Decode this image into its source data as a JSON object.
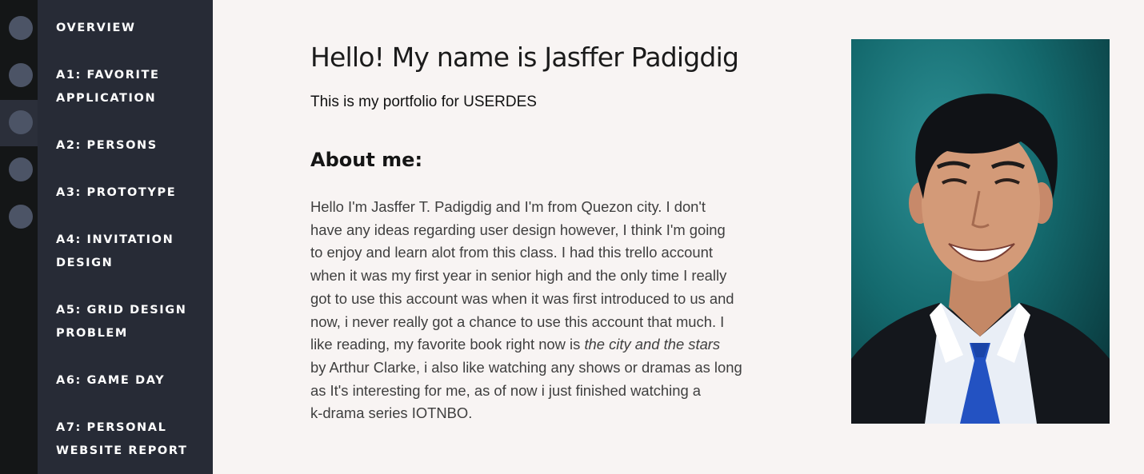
{
  "nav": {
    "items": [
      {
        "label": "OVERVIEW"
      },
      {
        "label": "A1: FAVORITE APPLICATION"
      },
      {
        "label": "A2: PERSONS"
      },
      {
        "label": "A3: PROTOTYPE"
      },
      {
        "label": "A4: INVITATION DESIGN"
      },
      {
        "label": "A5: GRID DESIGN PROBLEM"
      },
      {
        "label": "A6: GAME DAY"
      },
      {
        "label": "A7: PERSONAL WEBSITE REPORT"
      }
    ],
    "active_dot": 3
  },
  "main": {
    "heading": "Hello! My name is Jasffer Padigdig",
    "subheading": "This is my portfolio for USERDES",
    "about_title": "About me:",
    "bio": {
      "line1": "Hello I'm Jasffer T. Padigdig and I'm from Quezon city. I don't",
      "line2": "have any ideas regarding user design however, I think I'm going",
      "line3": "to enjoy and learn alot from this class. I had this trello account",
      "line4": "when it was my first year in senior high and the only time I really",
      "line5": "got to use this account was when it was first introduced to us and",
      "line6": "now, i never really got a chance to use this account that much. I",
      "line7_pre": "like reading, my favorite book right now is ",
      "line7_book": "the city and the stars",
      "line8": "by Arthur Clarke, i also like watching any shows or dramas as long",
      "line9": "as It's interesting for me, as of now i just finished watching a",
      "line10": "k-drama series IOTNBO."
    }
  },
  "colors": {
    "dotrail_bg": "#141617",
    "sidebar_bg": "#272b36",
    "dot": "#4c5466",
    "page_bg": "#f8f4f3"
  }
}
